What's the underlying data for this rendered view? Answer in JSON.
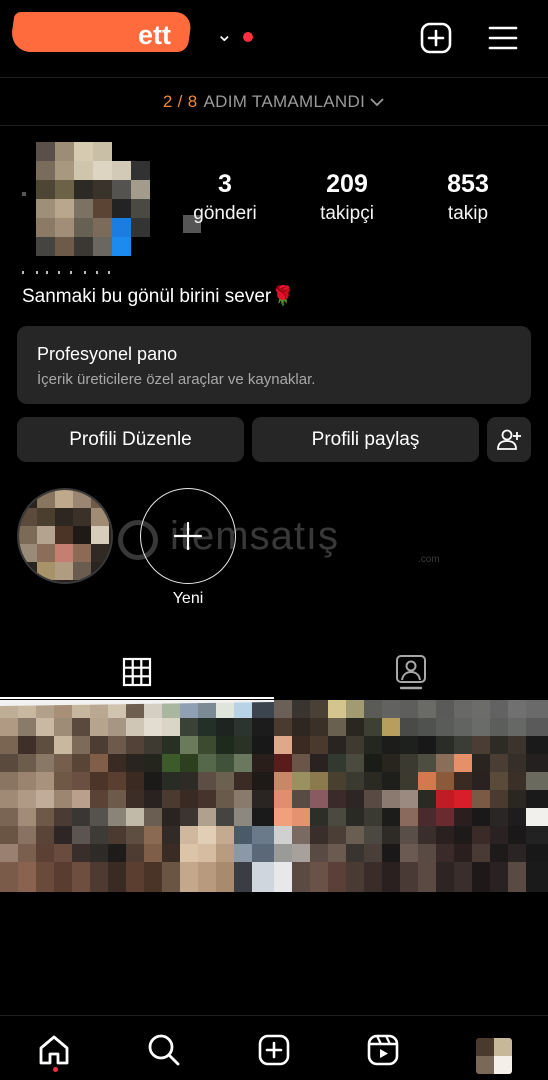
{
  "header": {
    "username": "ett",
    "menu_icon": "hamburger-icon",
    "create_icon": "plus-square-icon"
  },
  "steps": {
    "progress": "2 / 8",
    "label": "ADIM TAMAMLANDI"
  },
  "profile": {
    "stats": [
      {
        "value": "3",
        "label": "gönderi"
      },
      {
        "value": "209",
        "label": "takipçi"
      },
      {
        "value": "853",
        "label": "takip"
      }
    ],
    "bio": "Sanmaki bu gönül birini sever🌹"
  },
  "pro_panel": {
    "title": "Profesyonel pano",
    "subtitle": "İçerik üreticilere özel araçlar ve kaynaklar."
  },
  "buttons": {
    "edit": "Profili Düzenle",
    "share": "Profili paylaş"
  },
  "highlights": {
    "new_label": "Yeni"
  },
  "watermark": {
    "text": "itemsatış",
    "suffix": ".com"
  },
  "colors": {
    "background": "#000000",
    "surface": "#262626",
    "accent_orange": "#f08a3a",
    "notification_red": "#ff3040"
  }
}
